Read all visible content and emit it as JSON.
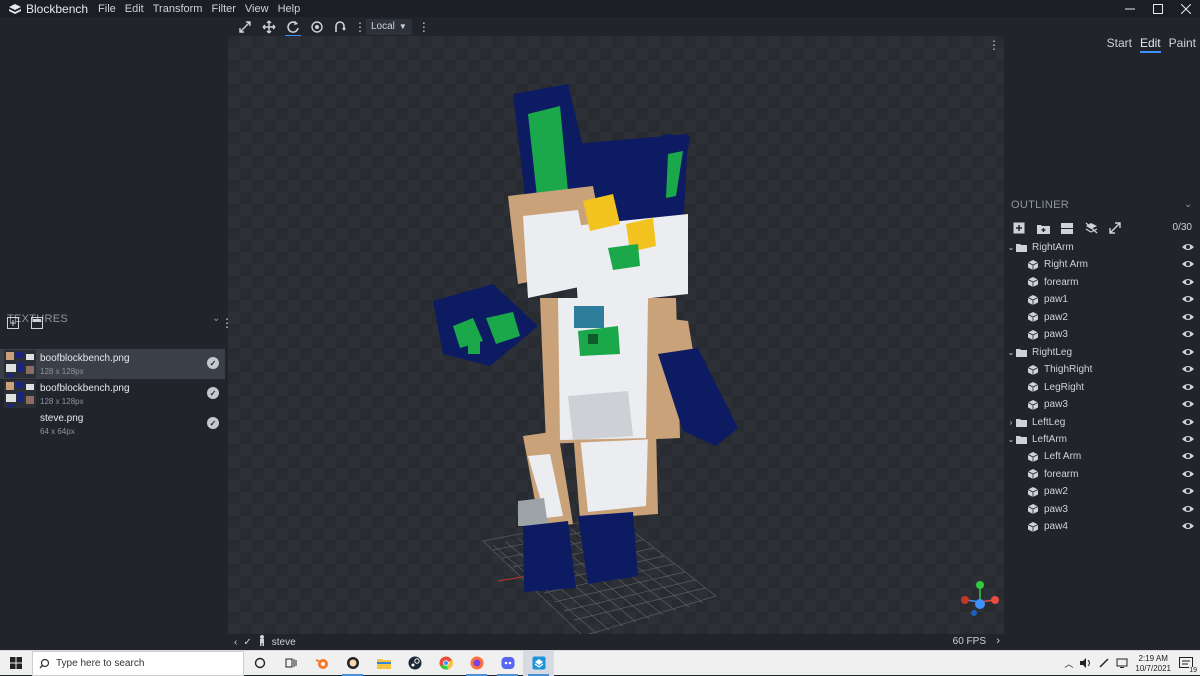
{
  "app": {
    "title": "Blockbench",
    "menu": [
      "File",
      "Edit",
      "Transform",
      "Filter",
      "View",
      "Help"
    ],
    "window_controls": [
      "minimize-icon",
      "maximize-icon",
      "close-icon"
    ]
  },
  "toolbar": {
    "tools": [
      "move-tool-icon",
      "resize-tool-icon",
      "rotate-tool-icon",
      "pivot-tool-icon",
      "vertex-snap-icon"
    ],
    "space_select": "Local"
  },
  "modes": {
    "start": "Start",
    "edit": "Edit",
    "paint": "Paint",
    "active": "Edit"
  },
  "textures": {
    "header": "TEXTURES",
    "items": [
      {
        "name": "boofblockbench.png",
        "size": "128 x 128px",
        "selected": true
      },
      {
        "name": "boofblockbench.png",
        "size": "128 x 128px",
        "selected": false
      },
      {
        "name": "steve.png",
        "size": "64 x 64px",
        "selected": false
      }
    ]
  },
  "outliner": {
    "header": "OUTLINER",
    "count": "0/30",
    "tree": [
      {
        "label": "RightArm",
        "type": "group",
        "level": 0,
        "expanded": true
      },
      {
        "label": "Right Arm",
        "type": "cube",
        "level": 1
      },
      {
        "label": "forearm",
        "type": "cube",
        "level": 1
      },
      {
        "label": "paw1",
        "type": "cube",
        "level": 1
      },
      {
        "label": "paw2",
        "type": "cube",
        "level": 1
      },
      {
        "label": "paw3",
        "type": "cube",
        "level": 1
      },
      {
        "label": "RightLeg",
        "type": "group",
        "level": 0,
        "expanded": true
      },
      {
        "label": "ThighRight",
        "type": "cube",
        "level": 1
      },
      {
        "label": "LegRight",
        "type": "cube",
        "level": 1
      },
      {
        "label": "paw3",
        "type": "cube",
        "level": 1
      },
      {
        "label": "LeftLeg",
        "type": "group",
        "level": 0,
        "expanded": false
      },
      {
        "label": "LeftArm",
        "type": "group",
        "level": 0,
        "expanded": true
      },
      {
        "label": "Left Arm",
        "type": "cube",
        "level": 1
      },
      {
        "label": "forearm",
        "type": "cube",
        "level": 1
      },
      {
        "label": "paw2",
        "type": "cube",
        "level": 1
      },
      {
        "label": "paw3",
        "type": "cube",
        "level": 1
      },
      {
        "label": "paw4",
        "type": "cube",
        "level": 1
      }
    ]
  },
  "statusbar": {
    "model_name": "steve",
    "fps": "60 FPS"
  },
  "taskbar": {
    "search_placeholder": "Type here to search",
    "time": "2:19 AM",
    "date": "10/7/2021",
    "notification_count": "19"
  },
  "colors": {
    "accent": "#3e90ff",
    "panel_bg": "#21252b",
    "viewport_bg": "#282b30"
  }
}
